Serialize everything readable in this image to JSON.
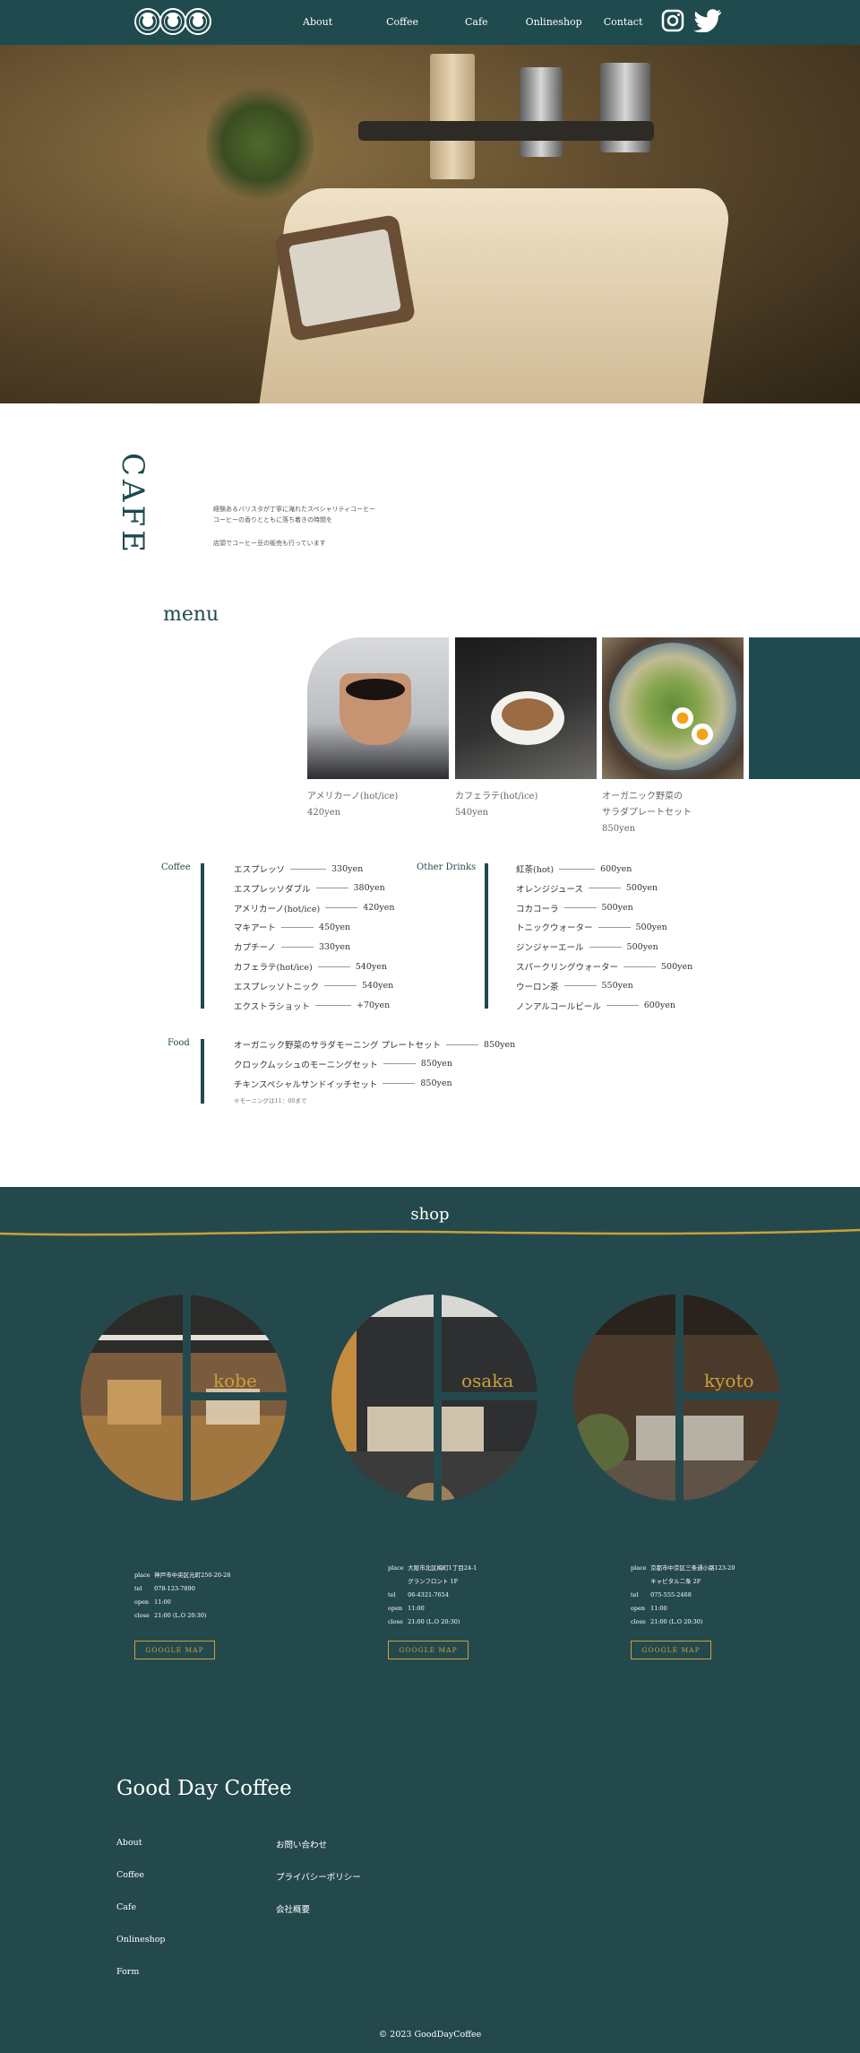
{
  "header": {
    "nav": [
      "About",
      "Coffee",
      "Cafe",
      "Onlineshop",
      "Contact"
    ],
    "social_icons": [
      "instagram-icon",
      "twitter-icon"
    ]
  },
  "cafe": {
    "title": "CAFE",
    "intro": [
      "経験あるバリスタが丁寧に淹れたスペシャリティコーヒー",
      "コーヒーの香りとともに落ち着きの時間を",
      "店頭でコーヒー豆の販売も行っています"
    ]
  },
  "menu": {
    "title": "menu",
    "cards": [
      {
        "name": "アメリカーノ(hot/ice)",
        "price": "420yen"
      },
      {
        "name": "カフェラテ(hot/ice)",
        "price": "540yen"
      },
      {
        "name_lines": [
          "オーガニック野菜の",
          "サラダプレートセット"
        ],
        "price": "850yen"
      }
    ]
  },
  "prices": {
    "coffee_label": "Coffee",
    "coffee": [
      {
        "name": "エスプレッソ",
        "price": "330yen"
      },
      {
        "name": "エスプレッソダブル",
        "price": "380yen"
      },
      {
        "name": "アメリカーノ(hot/ice)",
        "price": "420yen"
      },
      {
        "name": "マキアート",
        "price": "450yen"
      },
      {
        "name": "カプチーノ",
        "price": "330yen"
      },
      {
        "name": "カフェラテ(hot/ice)",
        "price": "540yen"
      },
      {
        "name": "エスプレッソトニック",
        "price": "540yen"
      },
      {
        "name": "エクストラショット",
        "price": "+70yen"
      }
    ],
    "drinks_label": "Other Drinks",
    "drinks": [
      {
        "name": "紅茶(hot)",
        "price": "600yen"
      },
      {
        "name": "オレンジジュース",
        "price": "500yen"
      },
      {
        "name": "コカコーラ",
        "price": "500yen"
      },
      {
        "name": "トニックウォーター",
        "price": "500yen"
      },
      {
        "name": "ジンジャーエール",
        "price": "500yen"
      },
      {
        "name": "スパークリングウォーター",
        "price": "500yen"
      },
      {
        "name": "ウーロン茶",
        "price": "550yen"
      },
      {
        "name": "ノンアルコールビール",
        "price": "600yen"
      }
    ],
    "food_label": "Food",
    "food": [
      {
        "name": "オーガニック野菜のサラダモーニング プレートセット",
        "price": "850yen"
      },
      {
        "name": "クロックムッシュのモーニングセット",
        "price": "850yen"
      },
      {
        "name": "チキンスペシャルサンドイッチセット",
        "price": "850yen"
      }
    ],
    "food_note": "※モーニングは11：00まで"
  },
  "shop": {
    "title": "shop",
    "map_button": "GOOGLE MAP",
    "stores": [
      {
        "name": "kobe",
        "place": "神戸市中央区元町250-20-28",
        "tel": "078-123-7890",
        "open": "11:00",
        "close": "21:00 (L.O 20:30)"
      },
      {
        "name": "osaka",
        "place": "大阪市北区梅町1丁目24-1",
        "place2": "グランフロント 1F",
        "tel": "06-4321-7654",
        "open": "11:00",
        "close": "21:00 (L.O 20:30)"
      },
      {
        "name": "kyoto",
        "place": "京都市中京区三条通小路123-20",
        "place2": "キャビタル二条 2F",
        "tel": "075-555-2468",
        "open": "11:00",
        "close": "21:00 (L.O 20:30)"
      }
    ],
    "labels": {
      "place": "place",
      "tel": "tel",
      "open": "open",
      "close": "close"
    }
  },
  "footer": {
    "brand": "Good Day Coffee",
    "links_left": [
      "About",
      "Coffee",
      "Cafe",
      "Onlineshop",
      "Form"
    ],
    "links_right": [
      "お問い合わせ",
      "プライバシーポリシー",
      "会社概要"
    ],
    "copyright": "© 2023 GoodDayCoffee"
  },
  "colors": {
    "primary": "#1f4a4e",
    "accent": "#c9a13a",
    "shop_bg": "#24494d"
  }
}
